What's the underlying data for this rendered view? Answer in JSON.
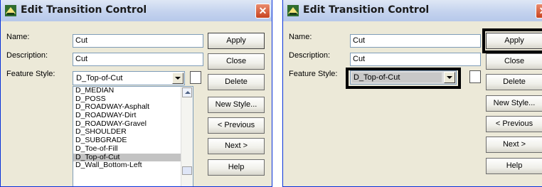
{
  "left_dialog": {
    "title": "Edit Transition Control",
    "close_glyph": "✕",
    "labels": {
      "name": "Name:",
      "description": "Description:",
      "feature_style": "Feature Style:"
    },
    "name_value": "Cut",
    "description_value": "Cut",
    "feature_style_value": "D_Top-of-Cut",
    "dropdown_items": [
      "D_MEDIAN",
      "D_POSS",
      "D_ROADWAY-Asphalt",
      "D_ROADWAY-Dirt",
      "D_ROADWAY-Gravel",
      "D_SHOULDER",
      "D_SUBGRADE",
      "D_Toe-of-Fill",
      "D_Top-of-Cut",
      "D_Wall_Bottom-Left"
    ],
    "selected_item": "D_Top-of-Cut",
    "buttons": {
      "apply": "Apply",
      "close": "Close",
      "delete": "Delete",
      "new_style": "New Style...",
      "previous": "< Previous",
      "next": "Next >",
      "help": "Help"
    }
  },
  "right_dialog": {
    "title": "Edit Transition Control",
    "close_glyph": "✕",
    "labels": {
      "name": "Name:",
      "description": "Description:",
      "feature_style": "Feature Style:"
    },
    "name_value": "Cut",
    "description_value": "Cut",
    "feature_style_value": "D_Top-of-Cut",
    "buttons": {
      "apply": "Apply",
      "close": "Close",
      "delete": "Delete",
      "new_style": "New Style...",
      "previous": "< Previous",
      "next": "Next >",
      "help": "Help"
    }
  },
  "icons": {
    "title_icon": "roadway-app-icon",
    "close": "close-icon",
    "dropdown": "chevron-down-icon"
  },
  "colors": {
    "title_bar": "#c4d3ee",
    "dialog_bg": "#ece9d8",
    "close_button": "#d4532c",
    "selection": "#c3c3c3"
  }
}
